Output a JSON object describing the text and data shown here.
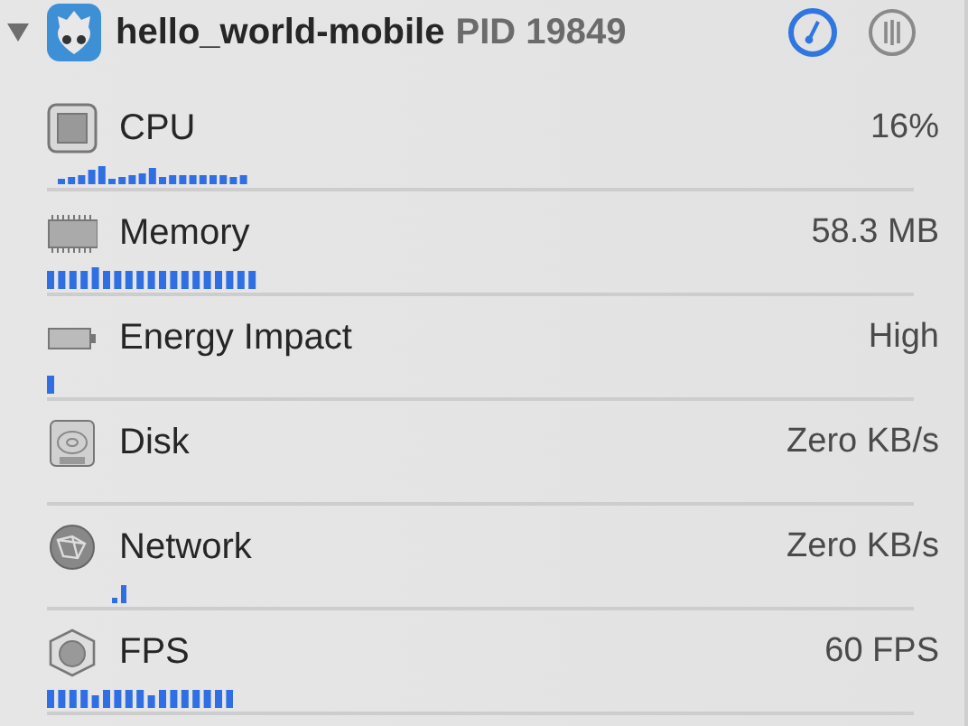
{
  "process": {
    "name": "hello_world-mobile",
    "pid": "PID 19849",
    "expanded": true
  },
  "gauges": [
    {
      "kind": "cpu",
      "label": "CPU",
      "value": "16%"
    },
    {
      "kind": "memory",
      "label": "Memory",
      "value": "58.3 MB"
    },
    {
      "kind": "energy",
      "label": "Energy Impact",
      "value": "High"
    },
    {
      "kind": "disk",
      "label": "Disk",
      "value": "Zero KB/s"
    },
    {
      "kind": "network",
      "label": "Network",
      "value": "Zero KB/s"
    },
    {
      "kind": "fps",
      "label": "FPS",
      "value": "60 FPS"
    }
  ]
}
